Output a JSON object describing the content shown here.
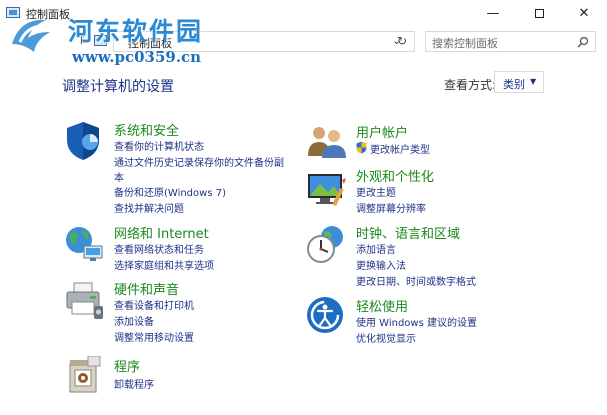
{
  "window": {
    "title": "控制面板"
  },
  "watermark": {
    "text": "河东软件园",
    "url": "www.pc0359.cn"
  },
  "navbar": {
    "back_arrow": "↑",
    "address": "控制面板",
    "search_placeholder": "搜索控制面板"
  },
  "header": {
    "title": "调整计算机的设置",
    "view_label": "查看方式:",
    "view_value": "类别"
  },
  "colors": {
    "link": "#1e3287",
    "category": "#19881d",
    "watermark": "#2a8ad4"
  },
  "categories": {
    "system": {
      "title": "系统和安全",
      "icon": "shield-icon",
      "links": [
        "查看你的计算机状态",
        "通过文件历史记录保存你的文件备份副",
        "本",
        "备份和还原(Windows 7)",
        "查找并解决问题"
      ]
    },
    "network": {
      "title": "网络和 Internet",
      "icon": "network-globe-icon",
      "links": [
        "查看网络状态和任务",
        "选择家庭组和共享选项"
      ]
    },
    "hardware": {
      "title": "硬件和声音",
      "icon": "printer-icon",
      "links": [
        "查看设备和打印机",
        "添加设备",
        "调整常用移动设置"
      ]
    },
    "programs": {
      "title": "程序",
      "icon": "programs-icon",
      "links": [
        "卸载程序"
      ]
    },
    "users": {
      "title": "用户帐户",
      "icon": "users-icon",
      "links": [
        "更改帐户类型"
      ]
    },
    "appearance": {
      "title": "外观和个性化",
      "icon": "monitor-paint-icon",
      "links": [
        "更改主题",
        "调整屏幕分辨率"
      ]
    },
    "clock": {
      "title": "时钟、语言和区域",
      "icon": "clock-globe-icon",
      "links": [
        "添加语言",
        "更换输入法",
        "更改日期、时间或数字格式"
      ]
    },
    "ease": {
      "title": "轻松使用",
      "icon": "ease-of-access-icon",
      "links": [
        "使用 Windows 建议的设置",
        "优化视觉显示"
      ]
    }
  }
}
